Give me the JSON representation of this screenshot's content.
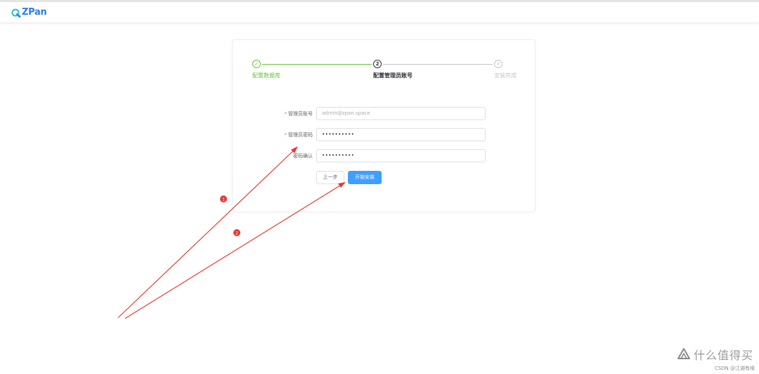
{
  "header": {
    "logo_text": "ZPan",
    "brand_color": "#2b7de9",
    "logo_accent": "#20c4c9"
  },
  "steps": [
    {
      "number": "✓",
      "title": "配置数据库",
      "status": "finish"
    },
    {
      "number": "2",
      "title": "配置管理员账号",
      "status": "process"
    },
    {
      "number": "3",
      "title": "安装完成",
      "status": "wait"
    }
  ],
  "form": {
    "account_label": "管理员账号",
    "account_value": "admin@zpan.space",
    "password_label": "管理员密码",
    "password_value": "••••••••••",
    "confirm_label": "密码确认",
    "confirm_value": "••••••••••",
    "required_mark": "*"
  },
  "buttons": {
    "prev_label": "上一步",
    "start_label": "开始安装"
  },
  "annotations": {
    "marker_1": "1",
    "marker_2": "2",
    "color": "#e53935"
  },
  "watermark": {
    "site_text": "什么值得买",
    "csdn_text": "CSDN @江湖有缘"
  },
  "colors": {
    "success": "#67c23a",
    "primary": "#409eff",
    "required": "#f56c6c"
  }
}
